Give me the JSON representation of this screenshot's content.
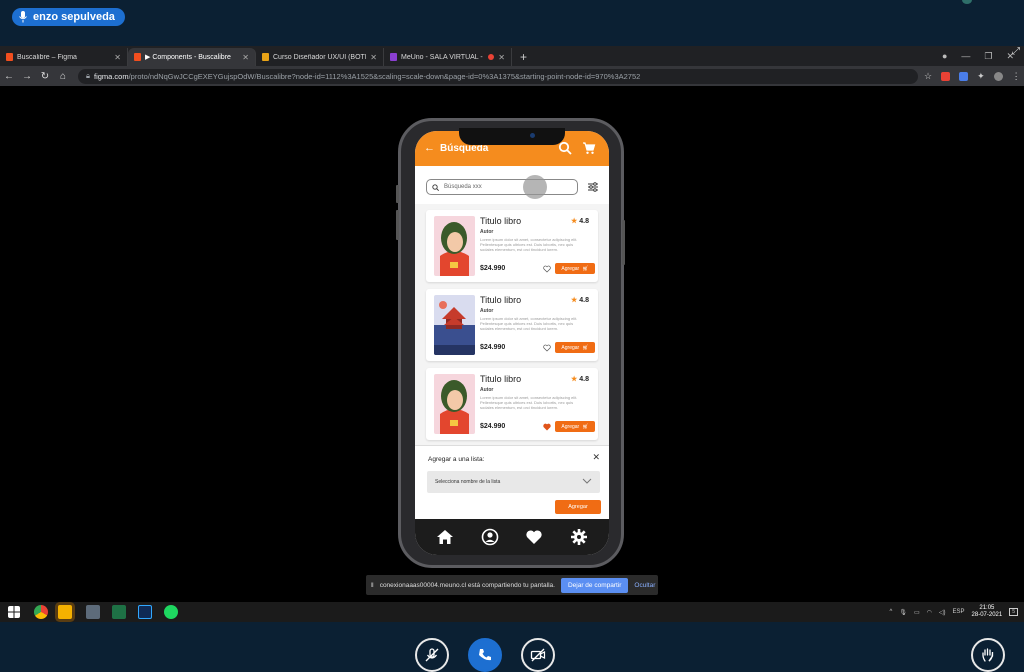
{
  "meeting": {
    "speaker_name": "enzo sepulveda",
    "share_notice": "conexionaaas00004.meuno.cl está compartiendo tu pantalla.",
    "stop_sharing_label": "Dejar de compartir",
    "hide_label": "Ocultar",
    "controls": [
      "mic-muted-icon",
      "phone-icon",
      "camera-off-icon",
      "raise-hand-icon"
    ]
  },
  "browser": {
    "tabs": [
      {
        "title": "Buscalibre – Figma",
        "favicon_color": "#f24e1e",
        "active": false
      },
      {
        "title": "▶ Components - Buscalibre",
        "favicon_color": "#f24e1e",
        "active": true
      },
      {
        "title": "Curso Diseñador UX/UI (BOTIC-",
        "favicon_color": "#e8a317",
        "active": false
      },
      {
        "title": "MeUno - SALA VIRTUAL - M",
        "favicon_color": "#8a3fd1",
        "active": false
      }
    ],
    "url_host": "figma.com",
    "url_path": "/proto/ndNqGwJCCgEXEYGujspOdW/Buscalibre?node-id=1112%3A1525&scaling=scale-down&page-id=0%3A1375&starting-point-node-id=970%3A2752"
  },
  "app": {
    "title": "Búsqueda",
    "search_placeholder": "Búsqueda xxx",
    "books": [
      {
        "title": "Titulo libro",
        "author": "Autor",
        "rating": "4.8",
        "price": "$24.990",
        "description": "Lorem ipsum dolor sit amet, consectetur adipiscing elit. Pellentesque quis ultrices est. Duis lobortis, nec quis sodales elementum, est orci tincidunt lorem.",
        "add_label": "Agregar",
        "favorite": false
      },
      {
        "title": "Titulo libro",
        "author": "Autor",
        "rating": "4.8",
        "price": "$24.990",
        "description": "Lorem ipsum dolor sit amet, consectetur adipiscing elit. Pellentesque quis ultrices est. Duis lobortis, nec quis sodales elementum, est orci tincidunt lorem.",
        "add_label": "Agregar",
        "favorite": false
      },
      {
        "title": "Titulo libro",
        "author": "Autor",
        "rating": "4.8",
        "price": "$24.990",
        "description": "Lorem ipsum dolor sit amet, consectetur adipiscing elit. Pellentesque quis ultrices est. Duis lobortis, nec quis sodales elementum, est orci tincidunt lorem.",
        "add_label": "Agregar",
        "favorite": true
      }
    ],
    "sheet": {
      "heading": "Agregar a una lista:",
      "select_placeholder": "Selecciona nombre de la lista",
      "button_label": "Agregar"
    },
    "colors": {
      "primary": "#f58c1e",
      "button": "#f06c14",
      "nav": "#1c1c1c"
    }
  },
  "taskbar": {
    "language": "ESP",
    "time": "21:05",
    "date": "28-07-2021",
    "notification_count": "5"
  }
}
